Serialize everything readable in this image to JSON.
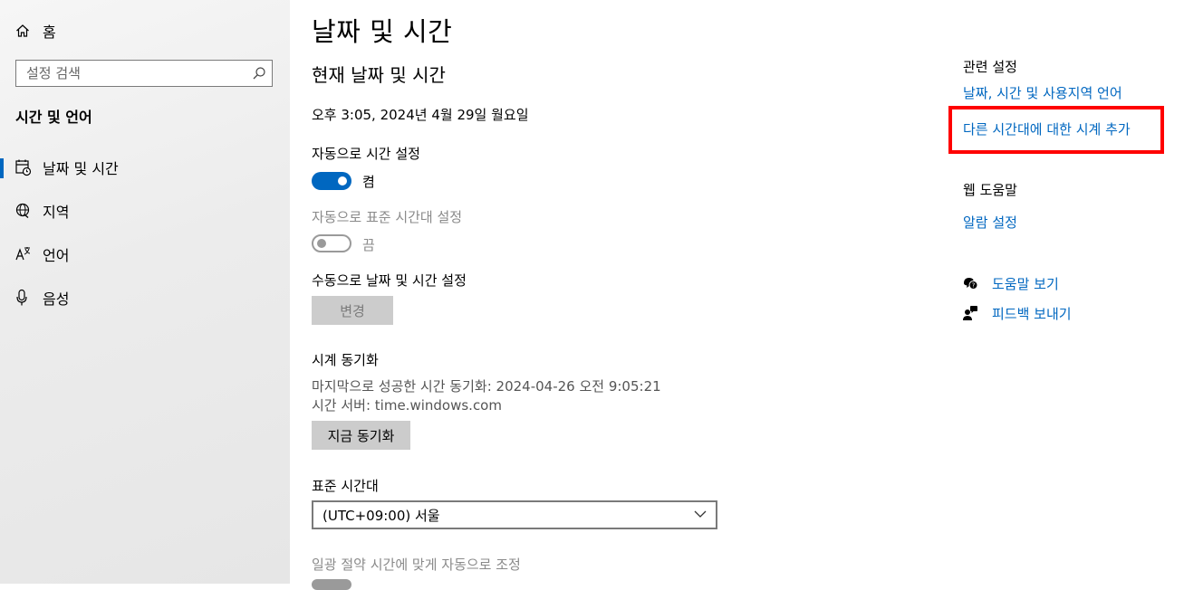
{
  "sidebar": {
    "home_label": "홈",
    "search_placeholder": "설정 검색",
    "section_title": "시간 및 언어",
    "items": [
      {
        "label": "날짜 및 시간",
        "icon": "calendar-clock-icon",
        "active": true
      },
      {
        "label": "지역",
        "icon": "globe-icon",
        "active": false
      },
      {
        "label": "언어",
        "icon": "language-icon",
        "active": false
      },
      {
        "label": "음성",
        "icon": "microphone-icon",
        "active": false
      }
    ]
  },
  "main": {
    "page_title": "날짜 및 시간",
    "section_heading": "현재 날짜 및 시간",
    "current_datetime": "오후 3:05, 2024년 4월 29일 월요일",
    "auto_time": {
      "label": "자동으로 시간 설정",
      "state_label": "켬",
      "on": true
    },
    "auto_timezone": {
      "label": "자동으로 표준 시간대 설정",
      "state_label": "끔",
      "on": false
    },
    "manual": {
      "label": "수동으로 날짜 및 시간 설정",
      "button_label": "변경"
    },
    "sync": {
      "heading": "시계 동기화",
      "last_sync": "마지막으로 성공한 시간 동기화: 2024-04-26 오전 9:05:21",
      "server": "시간 서버: time.windows.com",
      "button_label": "지금 동기화"
    },
    "timezone": {
      "label": "표준 시간대",
      "selected": "(UTC+09:00) 서울"
    },
    "dst": {
      "label": "일광 절약 시간에 맞게 자동으로 조정"
    }
  },
  "right": {
    "related_heading": "관련 설정",
    "related_links": [
      "날짜, 시간 및 사용지역 언어",
      "다른 시간대에 대한 시계 추가"
    ],
    "web_help_heading": "웹 도움말",
    "web_help_links": [
      "알람 설정"
    ],
    "help_link": "도움말 보기",
    "feedback_link": "피드백 보내기"
  },
  "colors": {
    "accent": "#0067c0",
    "highlight": "#ff0000"
  }
}
